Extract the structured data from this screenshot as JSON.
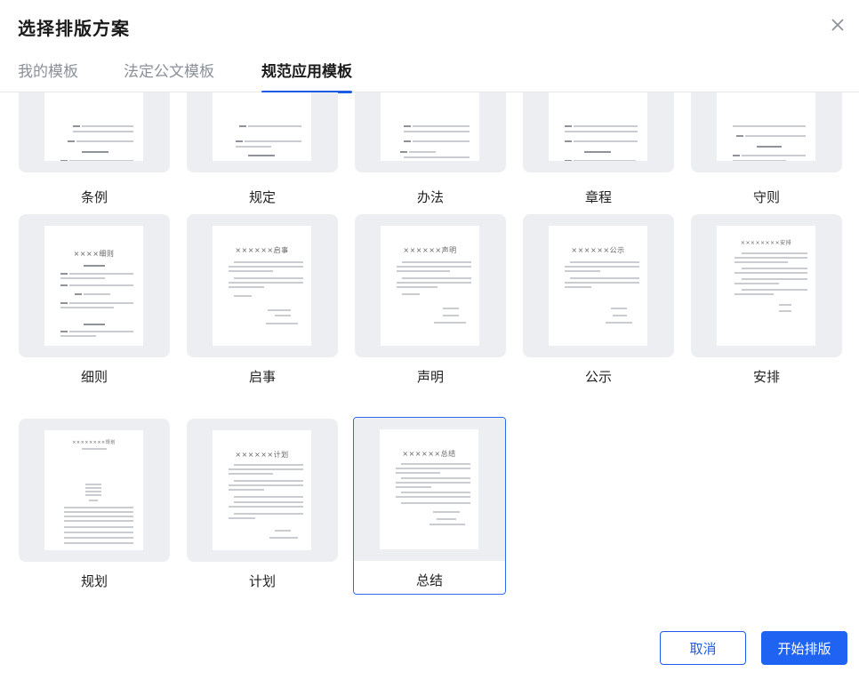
{
  "dialog": {
    "title": "选择排版方案"
  },
  "tabs": [
    {
      "label": "我的模板"
    },
    {
      "label": "法定公文模板"
    },
    {
      "label": "规范应用模板"
    }
  ],
  "templates": [
    {
      "label": "条例"
    },
    {
      "label": "规定"
    },
    {
      "label": "办法"
    },
    {
      "label": "章程"
    },
    {
      "label": "守则"
    },
    {
      "label": "细则"
    },
    {
      "label": "启事"
    },
    {
      "label": "声明"
    },
    {
      "label": "公示"
    },
    {
      "label": "安排"
    },
    {
      "label": "规划"
    },
    {
      "label": "计划"
    },
    {
      "label": "总结"
    }
  ],
  "thumb_titles": {
    "xize": "××××细则",
    "qishi": "××××××启事",
    "shengming": "××××××声明",
    "gongshi": "××××××公示",
    "anpai": "××××××××安排",
    "guihua": "××××××××规划",
    "jihua": "××××××计划",
    "zongjie": "××××××总结"
  },
  "footer": {
    "cancel": "取消",
    "start": "开始排版"
  },
  "colors": {
    "accent": "#1f63f2",
    "thumb_bg": "#eceef1"
  }
}
